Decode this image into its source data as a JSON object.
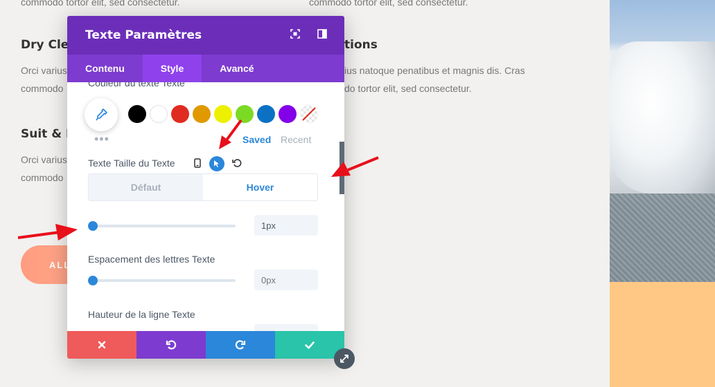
{
  "background": {
    "top_text_left": "commodo tortor elit, sed consectetur.",
    "top_text_right": "commodo tortor elit, sed consectetur.",
    "heading_dry": "Dry Clea",
    "text_dry_1": "Orci varius",
    "text_dry_2": "commodo",
    "heading_right": "tions",
    "text_right_1": "ius natoque penatibus et magnis dis. Cras",
    "text_right_2": "do tortor elit, sed consectetur.",
    "heading_suit": "Suit & D",
    "text_suit_1": "Orci varius",
    "text_suit_2": "commodo",
    "pill_button": "ALL"
  },
  "modal": {
    "title": "Texte Paramètres",
    "tabs": [
      {
        "label": "Contenu"
      },
      {
        "label": "Style"
      },
      {
        "label": "Avancé"
      }
    ],
    "cut_label": "Couleur du texte Texte",
    "swatches": [
      "#000000",
      "#ffffff",
      "#e02b20",
      "#e09900",
      "#edf000",
      "#7cda24",
      "#0c71c3",
      "#8300e9"
    ],
    "palette_more": "•••",
    "saved_label": "Saved",
    "recent_label": "Recent",
    "text_size_label": "Texte Taille du Texte",
    "toggle": {
      "default": "Défaut",
      "hover": "Hover"
    },
    "text_size_value": "1px",
    "letter_spacing_label": "Espacement des lettres Texte",
    "letter_spacing_placeholder": "0px",
    "line_height_label": "Hauteur de la ligne Texte",
    "text_size_fraction": 0.0,
    "letter_spacing_fraction": 0.0
  },
  "icons": {
    "expand": "expand-icon",
    "sidebar": "sidebar-layout-icon",
    "eyedropper": "eyedropper-icon",
    "no_color": "no-color-icon",
    "phone": "phone-icon",
    "cursor": "cursor-icon",
    "reset": "reset-icon",
    "cancel": "close-icon",
    "undo": "undo-icon",
    "redo": "redo-icon",
    "save": "check-icon",
    "resize": "resize-icon"
  },
  "colors": {
    "header": "#6c2eb9",
    "tabs": "#7d3bcf",
    "tab_active": "#8f42ec",
    "accent": "#2b87da",
    "cancel": "#ef5a5a",
    "undo": "#7e3bd0",
    "redo": "#2b87da",
    "save": "#29c4a9",
    "arrow": "#e8101a"
  }
}
